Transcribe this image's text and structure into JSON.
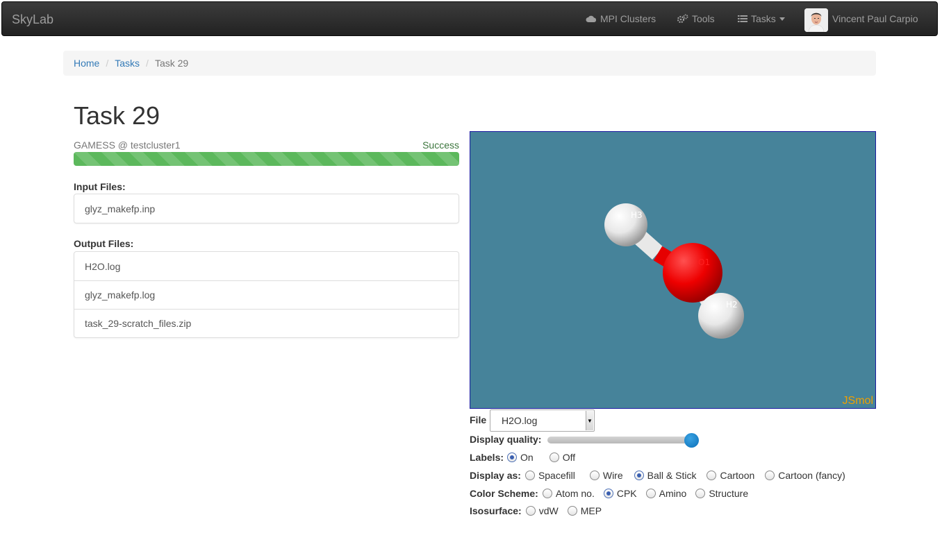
{
  "navbar": {
    "brand": "SkyLab",
    "items": [
      {
        "label": "MPI Clusters",
        "icon": "cloud-icon"
      },
      {
        "label": "Tools",
        "icon": "cogs-icon"
      },
      {
        "label": "Tasks",
        "icon": "tasks-icon"
      }
    ],
    "user_name": "Vincent Paul Carpio"
  },
  "breadcrumb": [
    "Home",
    "Tasks",
    "Task 29"
  ],
  "page_title": "Task 29",
  "job": {
    "label": "GAMESS @ testcluster1",
    "status": "Success",
    "progress_percent": 100
  },
  "input_files": {
    "label": "Input Files:",
    "items": [
      "glyz_makefp.inp"
    ]
  },
  "output_files": {
    "label": "Output Files:",
    "items": [
      "H2O.log",
      "glyz_makefp.log",
      "task_29-scratch_files.zip"
    ]
  },
  "viewer": {
    "watermark": "JSmol",
    "background_color": "#46839a",
    "atoms": [
      {
        "label": "H3",
        "element": "H"
      },
      {
        "label": "O1",
        "element": "O"
      },
      {
        "label": "H2",
        "element": "H"
      }
    ]
  },
  "controls": {
    "file_label": "File",
    "file_value": "H2O.log",
    "quality_label": "Display quality:",
    "quality_value": 1.0,
    "labels_label": "Labels:",
    "labels_options": [
      "On",
      "Off"
    ],
    "labels_selected": "On",
    "display_label": "Display as:",
    "display_options": [
      "Spacefill",
      "Wire",
      "Ball & Stick",
      "Cartoon",
      "Cartoon (fancy)"
    ],
    "display_selected": "Ball & Stick",
    "color_label": "Color Scheme:",
    "color_options": [
      "Atom no.",
      "CPK",
      "Amino",
      "Structure"
    ],
    "color_selected": "CPK",
    "iso_label": "Isosurface:",
    "iso_options": [
      "vdW",
      "MEP"
    ],
    "iso_selected": ""
  }
}
